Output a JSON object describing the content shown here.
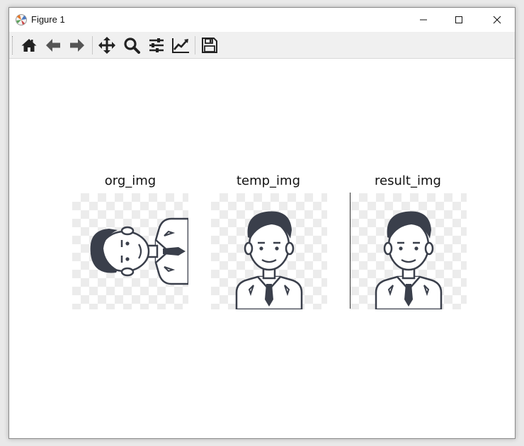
{
  "window": {
    "title": "Figure 1"
  },
  "toolbar": {
    "buttons": [
      {
        "name": "home",
        "icon": "home-icon"
      },
      {
        "name": "back",
        "icon": "arrow-left-icon"
      },
      {
        "name": "forward",
        "icon": "arrow-right-icon"
      },
      {
        "name": "pan",
        "icon": "move-icon"
      },
      {
        "name": "zoom",
        "icon": "magnifier-icon"
      },
      {
        "name": "configure-subplots",
        "icon": "sliders-icon"
      },
      {
        "name": "edit-axis",
        "icon": "line-chart-icon"
      },
      {
        "name": "save",
        "icon": "floppy-disk-icon"
      }
    ]
  },
  "panels": [
    {
      "title": "org_img",
      "image": "cartoon-man-avatar-rotated"
    },
    {
      "title": "temp_img",
      "image": "cartoon-man-avatar"
    },
    {
      "title": "result_img",
      "image": "cartoon-man-avatar"
    }
  ],
  "colors": {
    "icon": "#222222",
    "hair": "#3a3f4b",
    "checker": "#ececec"
  }
}
